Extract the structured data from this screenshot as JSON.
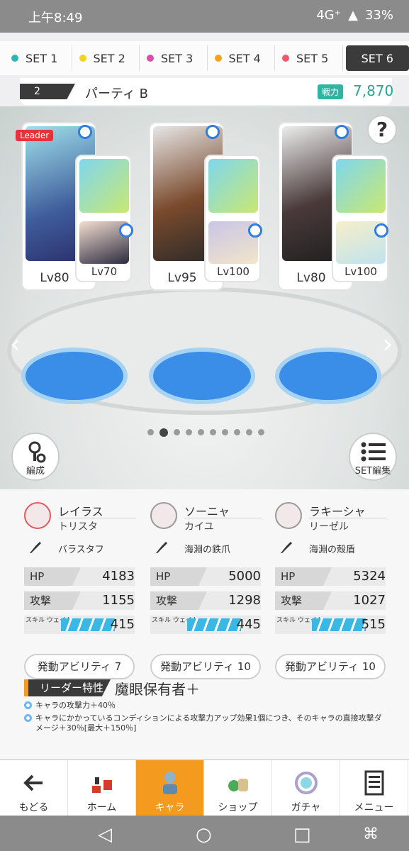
{
  "status_bar": {
    "time": "上午8:49",
    "network": "4G⁺",
    "battery": "33%"
  },
  "tabs": [
    {
      "label": "SET 1",
      "color": "#2fb6b2"
    },
    {
      "label": "SET 2",
      "color": "#f5d21e"
    },
    {
      "label": "SET 3",
      "color": "#d94fa6"
    },
    {
      "label": "SET 4",
      "color": "#f5a11e"
    },
    {
      "label": "SET 5",
      "color": "#ef5b6a"
    },
    {
      "label": "SET 6",
      "color": "",
      "active": true
    }
  ],
  "party": {
    "number": "2",
    "name": "パーティ B",
    "power_label": "戦力",
    "power": "7,870"
  },
  "stage": {
    "leader_badge": "Leader",
    "help": "?",
    "page_count": 10,
    "current_page": 2,
    "left_button_label": "編成",
    "right_button_label": "SET編集",
    "slots": [
      {
        "main_level": "Lv80",
        "sub_level": "Lv70"
      },
      {
        "main_level": "Lv95",
        "sub_level": "Lv100"
      },
      {
        "main_level": "Lv80",
        "sub_level": "Lv100"
      }
    ]
  },
  "characters": [
    {
      "name": "レイラス",
      "sub": "トリスタ",
      "weapon": "バラスタフ",
      "hp_label": "HP",
      "hp": "4183",
      "atk_label": "攻撃",
      "atk": "1155",
      "wait_label": "スキル ウェイト",
      "wait": "415",
      "ability": "発動アビリティ 7"
    },
    {
      "name": "ソーニャ",
      "sub": "カイユ",
      "weapon": "海淵の鉄爪",
      "hp_label": "HP",
      "hp": "5000",
      "atk_label": "攻撃",
      "atk": "1298",
      "wait_label": "スキル ウェイト",
      "wait": "445",
      "ability": "発動アビリティ 10"
    },
    {
      "name": "ラキーシャ",
      "sub": "リーゼル",
      "weapon": "海淵の殻盾",
      "hp_label": "HP",
      "hp": "5324",
      "atk_label": "攻撃",
      "atk": "1027",
      "wait_label": "スキル ウェイト",
      "wait": "515",
      "ability": "発動アビリティ 10"
    }
  ],
  "leader_skill": {
    "tag": "リーダー特性",
    "name": "魔眼保有者＋",
    "effects": [
      "キャラの攻撃力＋40％",
      "キャラにかかっているコンディションによる攻撃力アップ効果1個につき、そのキャラの直接攻撃ダメージ＋30％[最大＋150％]"
    ]
  },
  "bottom_nav": [
    {
      "label": "もどる",
      "icon": "back-arrow-icon"
    },
    {
      "label": "ホーム",
      "icon": "home-icon"
    },
    {
      "label": "キャラ",
      "icon": "character-icon",
      "active": true
    },
    {
      "label": "ショップ",
      "icon": "shop-icon"
    },
    {
      "label": "ガチャ",
      "icon": "gacha-icon"
    },
    {
      "label": "メニュー",
      "icon": "menu-icon"
    }
  ]
}
